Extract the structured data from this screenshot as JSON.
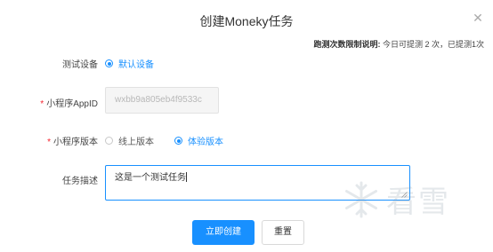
{
  "dialog": {
    "title": "创建Moneky任务",
    "close_icon": "close-icon"
  },
  "limit": {
    "label": "跑测次数限制说明:",
    "text": "今日可提测 2 次，已提测1次"
  },
  "form": {
    "device": {
      "label": "测试设备",
      "option": "默认设备",
      "checked": true
    },
    "appid": {
      "label": "小程序AppID",
      "required": true,
      "value": "wxbb9a805eb4f9533c"
    },
    "version": {
      "label": "小程序版本",
      "required": true,
      "options": [
        {
          "label": "线上版本",
          "checked": false
        },
        {
          "label": "体验版本",
          "checked": true
        }
      ]
    },
    "description": {
      "label": "任务描述",
      "value": "这是一个测试任务"
    }
  },
  "buttons": {
    "create": "立即创建",
    "reset": "重置"
  },
  "watermark": {
    "text": "看雪",
    "icon": "snowflake-icon"
  },
  "colors": {
    "primary": "#1890ff",
    "required": "#f5222d"
  }
}
